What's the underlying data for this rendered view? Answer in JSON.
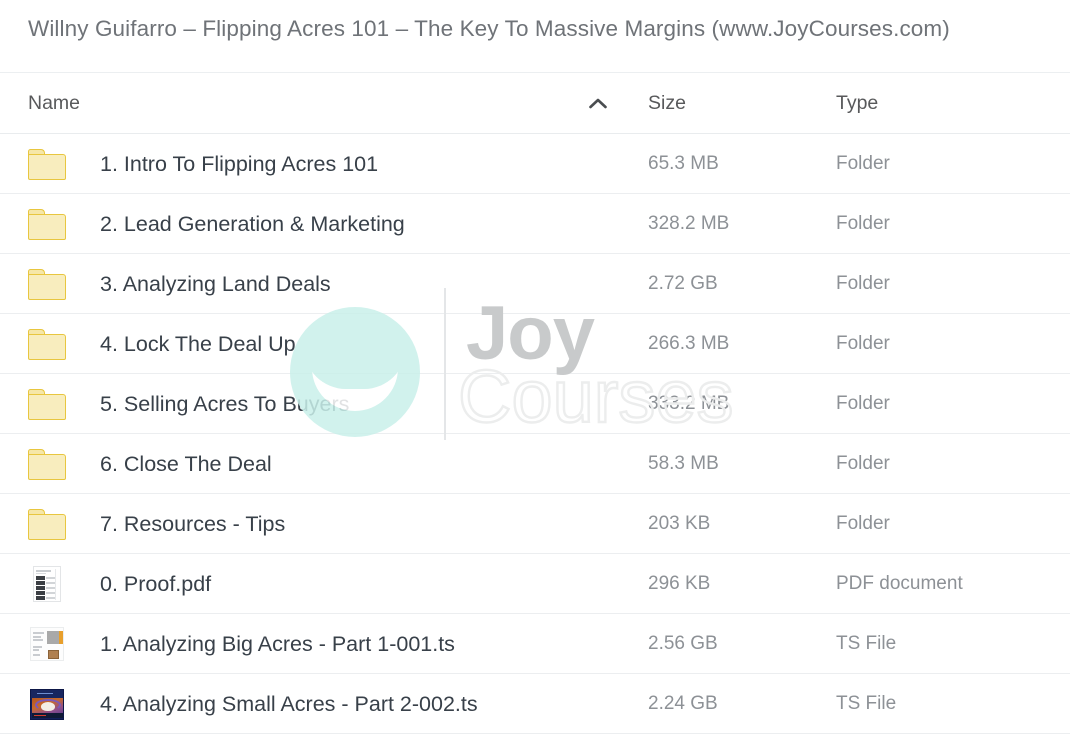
{
  "window": {
    "title": "Willny Guifarro – Flipping Acres 101 – The Key To Massive Margins (www.JoyCourses.com)"
  },
  "columns": {
    "name": "Name",
    "size": "Size",
    "type": "Type",
    "sort_icon": "chevron-up-icon",
    "sorted_by": "Name",
    "sort_direction": "ascending"
  },
  "colors": {
    "title_text": "#6f7378",
    "header_text": "#58595b",
    "name_text": "#384049",
    "meta_text": "#8d9196",
    "row_divider": "#eceef0",
    "folder_border": "#e8c63f",
    "folder_fill": "#f8edbe",
    "watermark_circle": "#c9f0ea",
    "watermark_joy": "#c8cacb"
  },
  "watermark": {
    "brand_line1": "Joy",
    "brand_line2": "Courses",
    "logo": "smiley-circle-logo"
  },
  "files": [
    {
      "icon": "folder-icon",
      "name": "1. Intro To Flipping Acres 101",
      "size": "65.3 MB",
      "type": "Folder"
    },
    {
      "icon": "folder-icon",
      "name": "2. Lead Generation & Marketing",
      "size": "328.2 MB",
      "type": "Folder"
    },
    {
      "icon": "folder-icon",
      "name": "3. Analyzing Land Deals",
      "size": "2.72 GB",
      "type": "Folder"
    },
    {
      "icon": "folder-icon",
      "name": "4. Lock The Deal Up",
      "size": "266.3 MB",
      "type": "Folder"
    },
    {
      "icon": "folder-icon",
      "name": "5. Selling Acres To Buyers",
      "size": "333.2 MB",
      "type": "Folder"
    },
    {
      "icon": "folder-icon",
      "name": "6. Close The Deal",
      "size": "58.3 MB",
      "type": "Folder"
    },
    {
      "icon": "folder-icon",
      "name": "7. Resources - Tips",
      "size": "203 KB",
      "type": "Folder"
    },
    {
      "icon": "pdf-thumbnail-icon",
      "name": "0. Proof.pdf",
      "size": "296 KB",
      "type": "PDF document"
    },
    {
      "icon": "ts-slide-thumbnail-icon",
      "name": "1. Analyzing Big Acres - Part 1-001.ts",
      "size": "2.56 GB",
      "type": "TS File"
    },
    {
      "icon": "ts-video-thumbnail-icon",
      "name": "4. Analyzing Small Acres - Part 2-002.ts",
      "size": "2.24 GB",
      "type": "TS File"
    }
  ]
}
